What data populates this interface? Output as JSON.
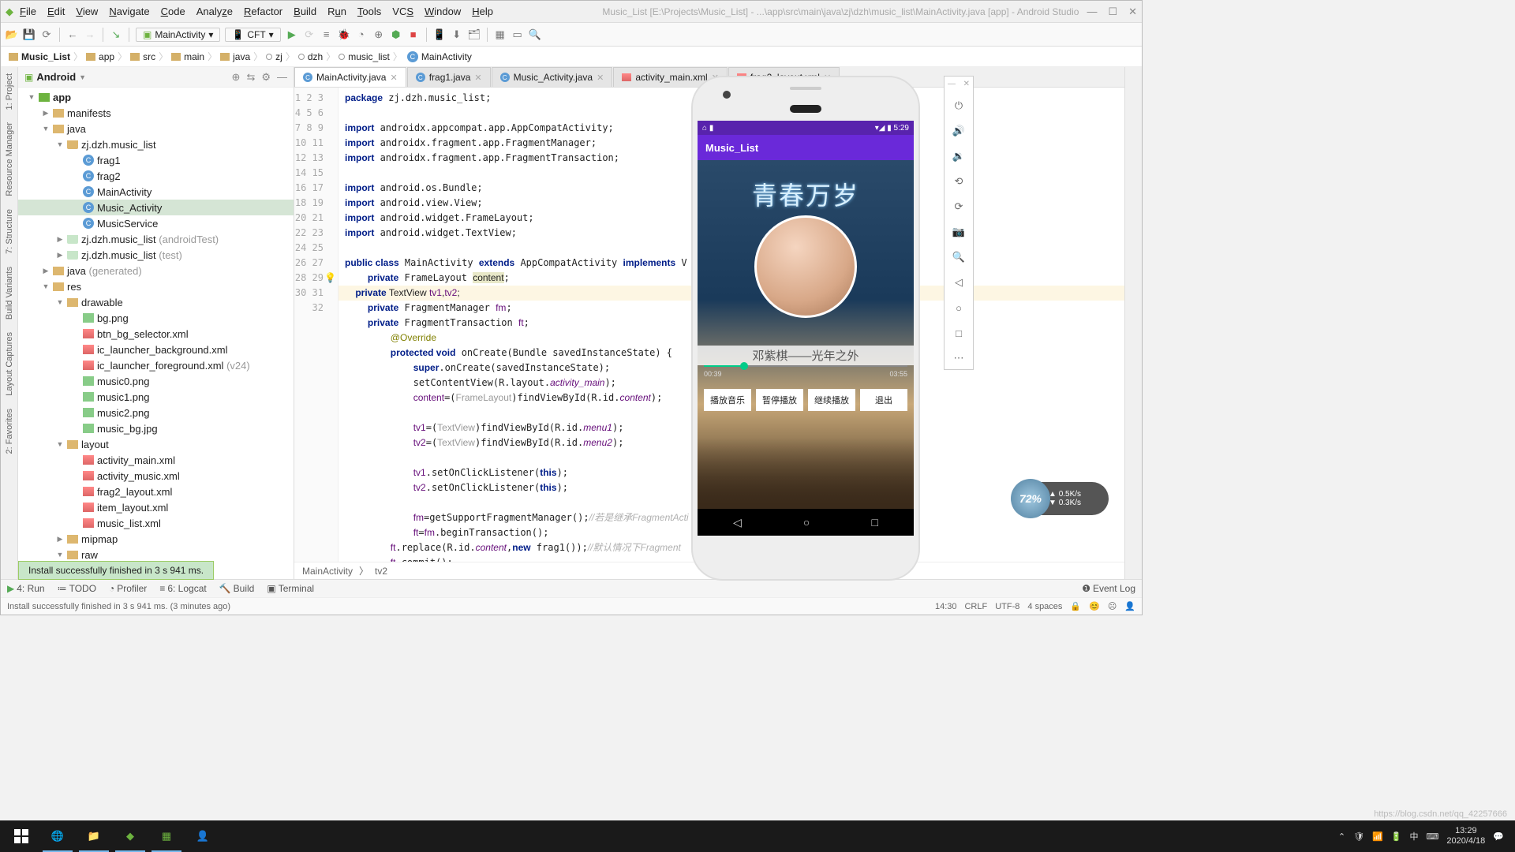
{
  "title": "Music_List [E:\\Projects\\Music_List] - ...\\app\\src\\main\\java\\zj\\dzh\\music_list\\MainActivity.java [app] - Android Studio",
  "menu": [
    "File",
    "Edit",
    "View",
    "Navigate",
    "Code",
    "Analyze",
    "Refactor",
    "Build",
    "Run",
    "Tools",
    "VCS",
    "Window",
    "Help"
  ],
  "config1": "MainActivity",
  "config2": "CFT",
  "breadcrumb": [
    "Music_List",
    "app",
    "src",
    "main",
    "java",
    "zj",
    "dzh",
    "music_list",
    "MainActivity"
  ],
  "pane_title": "Android",
  "left_rails": [
    "1: Project",
    "Resource Manager",
    "7: Structure",
    "Build Variants",
    "Layout Captures",
    "2: Favorites"
  ],
  "tree": {
    "app": "app",
    "manifests": "manifests",
    "java": "java",
    "pkg": "zj.dzh.music_list",
    "frag1": "frag1",
    "frag2": "frag2",
    "mainact": "MainActivity",
    "musicact": "Music_Activity",
    "musicsvc": "MusicService",
    "test1a": "zj.dzh.music_list",
    "test1b": "(androidTest)",
    "test2a": "zj.dzh.music_list",
    "test2b": "(test)",
    "gen": "java",
    "genb": "(generated)",
    "res": "res",
    "drawable": "drawable",
    "bg": "bg.png",
    "btn": "btn_bg_selector.xml",
    "icbg": "ic_launcher_background.xml",
    "icfg": "ic_launcher_foreground.xml",
    "icfgv": "(v24)",
    "m0": "music0.png",
    "m1": "music1.png",
    "m2": "music2.png",
    "mbg": "music_bg.jpg",
    "layout": "layout",
    "l1": "activity_main.xml",
    "l2": "activity_music.xml",
    "l3": "frag2_layout.xml",
    "l4": "item_layout.xml",
    "l5": "music_list.xml",
    "mipmap": "mipmap",
    "raw": "raw"
  },
  "tabs": [
    "MainActivity.java",
    "frag1.java",
    "Music_Activity.java",
    "activity_main.xml",
    "frag2_layout.xml"
  ],
  "crumb2": {
    "a": "MainActivity",
    "b": "tv2"
  },
  "install": "Install successfully finished in 3 s 941 ms.",
  "bottom": {
    "run": "4: Run",
    "todo": "TODO",
    "profiler": "Profiler",
    "logcat": "6: Logcat",
    "build": "Build",
    "terminal": "Terminal",
    "event": "Event Log"
  },
  "status_l": "Install successfully finished in 3 s 941 ms. (3 minutes ago)",
  "status_r": {
    "time": "14:30",
    "eol": "CRLF",
    "enc": "UTF-8",
    "ind": "4 spaces"
  },
  "app": {
    "title": "Music_List",
    "time": "5:29",
    "song": "邓紫棋——光年之外",
    "t1": "00:39",
    "t2": "03:55",
    "b1": "播放音乐",
    "b2": "暂停播放",
    "b3": "继续播放",
    "b4": "退出",
    "bg": "青春万岁"
  },
  "net": {
    "pct": "72%",
    "up": "0.5K/s",
    "dn": "0.3K/s"
  },
  "tb_time": "13:29",
  "tb_date": "2020/4/18",
  "watermark": "https://blog.csdn.net/qq_42257666"
}
